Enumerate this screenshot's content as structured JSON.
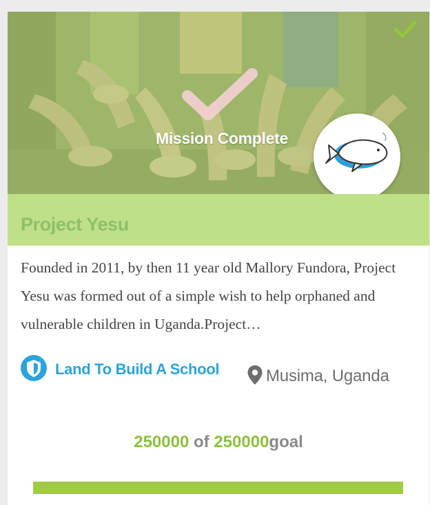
{
  "project": {
    "status_label": "Mission Complete",
    "title": "Project Yesu",
    "description": "Founded in 2011, by then 11 year old Mallory Fundora, Project Yesu was formed out of a simple wish to help orphaned and vulnerable children in Uganda.Project…",
    "category": "Land To Build A School",
    "location": "Musima, Uganda"
  },
  "funding": {
    "raised": "250000",
    "of_word": "of",
    "goal": "250000",
    "goal_word": "goal",
    "progress_fraction": 1.0
  },
  "icons": {
    "status": "check-icon",
    "corner": "check-icon",
    "category": "shield-icon",
    "location": "map-pin-icon",
    "logo": "beluga-whale-logo"
  },
  "colors": {
    "accent_green": "#8cc03e",
    "title_band": "#bfdf88",
    "title_text": "#8cc06b",
    "category_blue": "#2ca3dc",
    "progress_fill": "#9fcb45"
  }
}
